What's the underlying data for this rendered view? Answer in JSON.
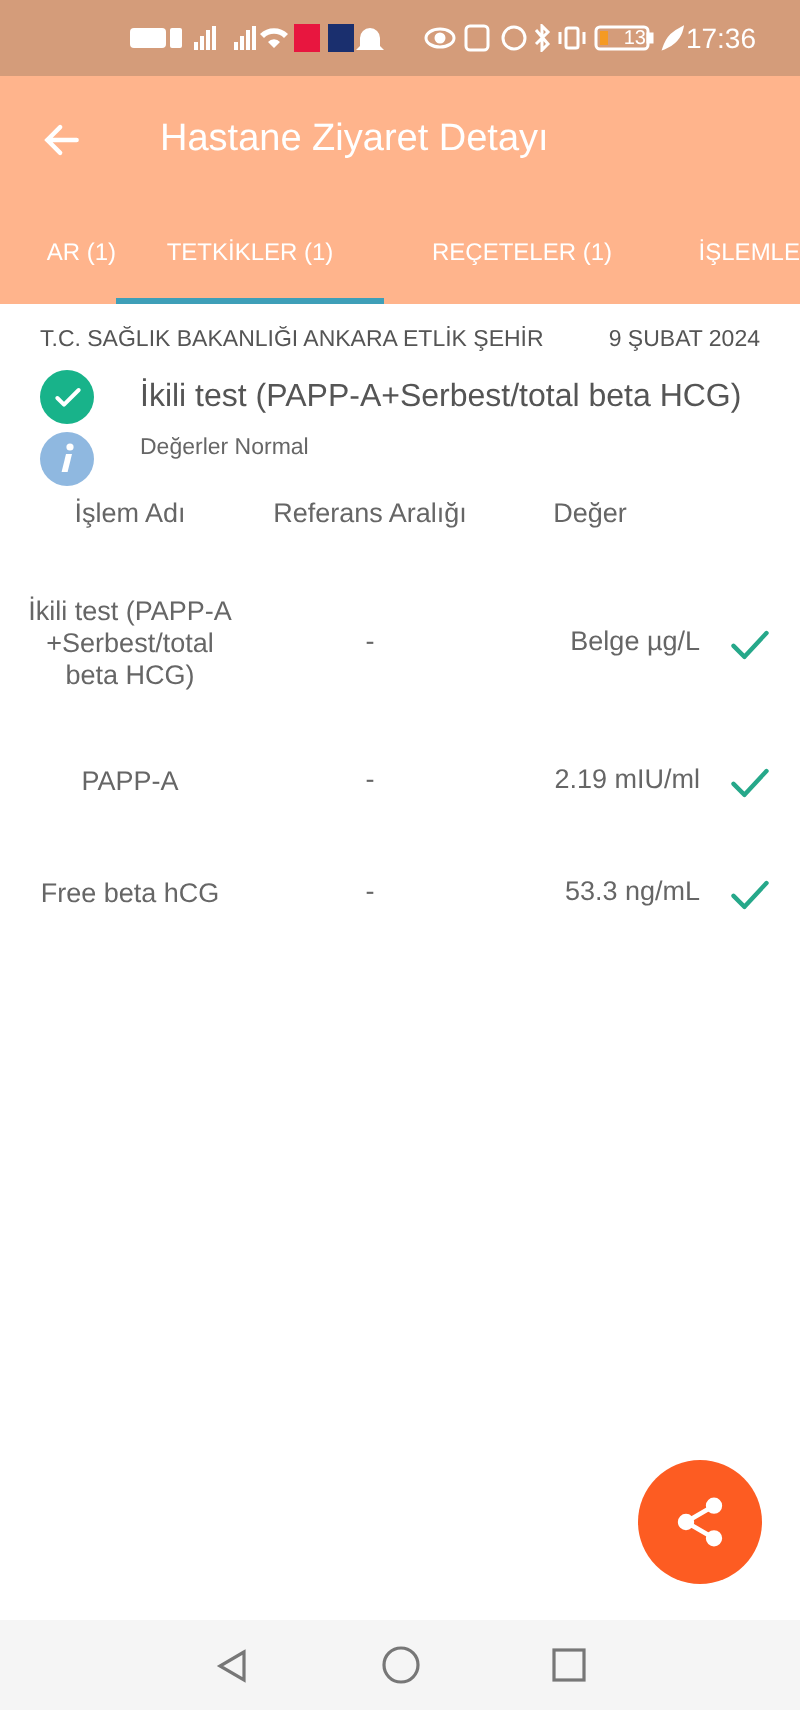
{
  "status_bar": {
    "battery": "13",
    "time": "17:36"
  },
  "app_bar": {
    "title": "Hastane Ziyaret Detayı"
  },
  "tabs": [
    {
      "label": "AR (1)",
      "selected": false
    },
    {
      "label": "TETKİKLER (1)",
      "selected": true
    },
    {
      "label": "REÇETELER (1)",
      "selected": false
    },
    {
      "label": "İŞLEMLE",
      "selected": false
    }
  ],
  "report": {
    "hospital": "T.C. SAĞLIK BAKANLIĞI ANKARA ETLİK ŞEHİR",
    "date": "9 ŞUBAT 2024",
    "title": "İkili test (PAPP-A+Serbest/total beta HCG)",
    "note": "Değerler Normal"
  },
  "table": {
    "columns": [
      "İşlem Adı",
      "Referans Aralığı",
      "Değer"
    ],
    "rows": [
      {
        "name": "İkili test (PAPP-A +Serbest/total beta HCG)",
        "range": "-",
        "value": "Belge µg/L",
        "ok": true
      },
      {
        "name": "PAPP-A",
        "range": "-",
        "value": "2.19 mIU/ml",
        "ok": true
      },
      {
        "name": "Free beta hCG",
        "range": "-",
        "value": "53.3 ng/mL",
        "ok": true
      }
    ]
  }
}
